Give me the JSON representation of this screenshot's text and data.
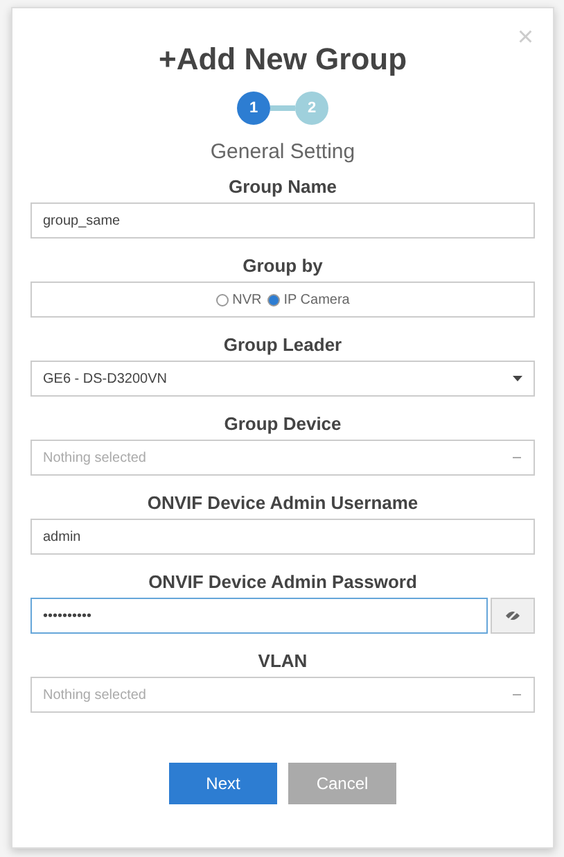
{
  "dialog": {
    "title": "+Add New Group",
    "close": "×",
    "steps": [
      {
        "label": "1",
        "selected": true
      },
      {
        "label": "2",
        "selected": false
      }
    ],
    "step_title": "General Setting",
    "fields": [
      {
        "kind": "text",
        "label": "Group Name",
        "value": "group_same"
      },
      {
        "kind": "radio",
        "label": "Group by",
        "options": [
          {
            "label": "NVR",
            "selected": false
          },
          {
            "label": "IP Camera",
            "selected": true
          }
        ]
      },
      {
        "kind": "select",
        "label": "Group Leader",
        "value": "GE6 - DS-D3200VN"
      },
      {
        "kind": "select",
        "label": "Group Device",
        "placeholder": "Nothing selected"
      },
      {
        "kind": "text",
        "label": "ONVIF Device Admin Username",
        "value": "admin"
      },
      {
        "kind": "password",
        "label": "ONVIF Device Admin Password",
        "value": "••••••••••"
      },
      {
        "kind": "select",
        "label": "VLAN",
        "placeholder": "Nothing selected"
      }
    ],
    "buttons": [
      {
        "label": "Next",
        "kind": "primary"
      },
      {
        "label": "Cancel",
        "kind": "secondary"
      }
    ]
  }
}
